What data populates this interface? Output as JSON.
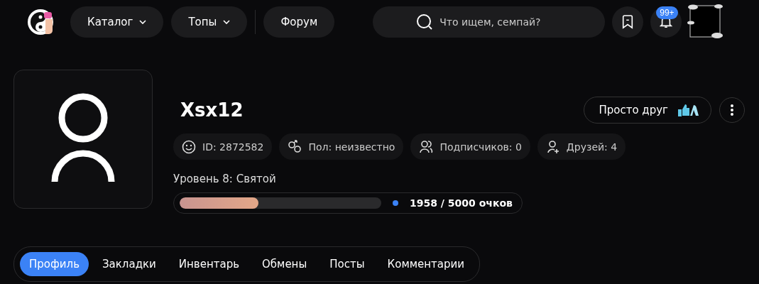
{
  "nav": [
    {
      "label": "Каталог",
      "dropdown": true
    },
    {
      "label": "Топы",
      "dropdown": true
    },
    {
      "label": "Форум",
      "dropdown": false
    }
  ],
  "search": {
    "placeholder": "Что ищем, семпай?"
  },
  "notifications": {
    "badge": "99+"
  },
  "profile": {
    "name": "Xsx12",
    "friend_button": "Просто друг",
    "stats": [
      {
        "kind": "id",
        "text": "ID: 2872582"
      },
      {
        "kind": "gender",
        "text": "Пол: неизвестно"
      },
      {
        "kind": "subscribers",
        "text": "Подписчиков: 0"
      },
      {
        "kind": "friends",
        "text": "Друзей: 4"
      }
    ],
    "level_label": "Уровень 8: Святой",
    "progress": {
      "level": 0.39,
      "reading": "1958 / 5000 очков"
    }
  },
  "tabs": [
    {
      "label": "Профиль",
      "selected": true
    },
    {
      "label": "Закладки",
      "selected": false
    },
    {
      "label": "Инвентарь",
      "selected": false
    },
    {
      "label": "Обмены",
      "selected": false
    },
    {
      "label": "Посты",
      "selected": false
    },
    {
      "label": "Комментарии",
      "selected": false
    }
  ]
}
